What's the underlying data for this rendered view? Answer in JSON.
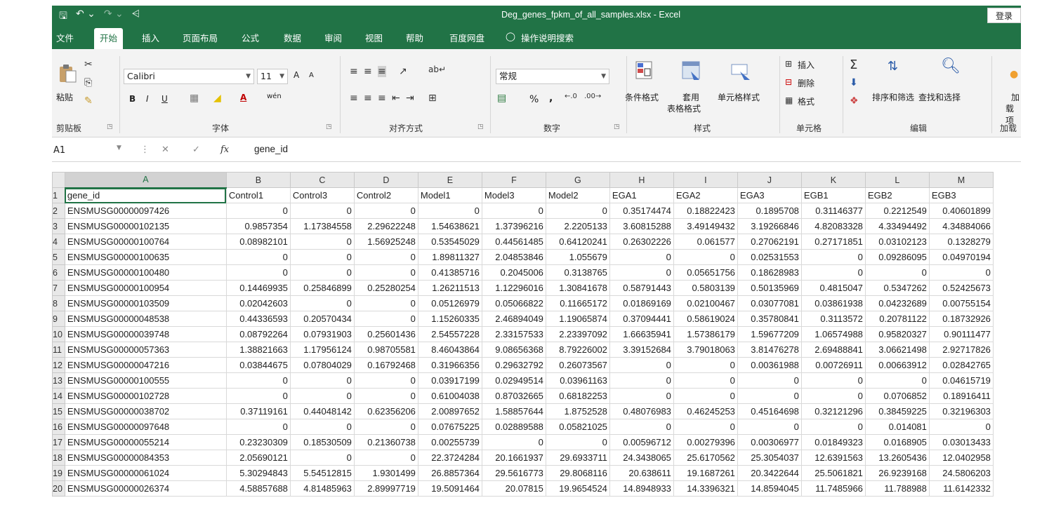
{
  "window": {
    "title": "Deg_genes_fpkm_of_all_samples.xlsx  -  Excel",
    "login": "登录",
    "qat_icons": [
      "save-icon",
      "undo-icon",
      "redo-icon",
      "customize-icon"
    ]
  },
  "tabs": [
    "文件",
    "开始",
    "插入",
    "页面布局",
    "公式",
    "数据",
    "审阅",
    "视图",
    "帮助",
    "百度网盘",
    "操作说明搜索"
  ],
  "active_tab": "开始",
  "ribbon": {
    "clipboard": {
      "paste": "粘贴",
      "group": "剪贴板"
    },
    "font": {
      "name": "Calibri",
      "size": "11",
      "bold": "B",
      "italic": "I",
      "underline": "U",
      "group": "字体",
      "grow": "A",
      "shrink": "A",
      "phonetic": "wén"
    },
    "alignment": {
      "group": "对齐方式"
    },
    "number": {
      "format": "常规",
      "percent": "%",
      "comma": ",",
      "group": "数字"
    },
    "styles": {
      "conditional": "条件格式",
      "table1": "套用",
      "table2": "表格格式",
      "cell_styles": "单元格样式",
      "group": "样式"
    },
    "cells": {
      "insert": "插入",
      "delete": "删除",
      "format": "格式",
      "group": "单元格"
    },
    "editing": {
      "sort": "排序和筛选",
      "find": "查找和选择",
      "group": "编辑"
    },
    "addins": {
      "label1": "加",
      "label2": "载项",
      "group": "加载"
    }
  },
  "formula_bar": {
    "name_box": "A1",
    "fx": "fx",
    "formula": "gene_id"
  },
  "grid": {
    "columns": [
      "A",
      "B",
      "C",
      "D",
      "E",
      "F",
      "G",
      "H",
      "I",
      "J",
      "K",
      "L",
      "M"
    ],
    "selected_cell": "A1",
    "rows": [
      {
        "n": "1",
        "cells": [
          "gene_id",
          "Control1",
          "Control3",
          "Control2",
          "Model1",
          "Model3",
          "Model2",
          "EGA1",
          "EGA2",
          "EGA3",
          "EGB1",
          "EGB2",
          "EGB3"
        ]
      },
      {
        "n": "2",
        "cells": [
          "ENSMUSG00000097426",
          "0",
          "0",
          "0",
          "0",
          "0",
          "0",
          "0.35174474",
          "0.18822423",
          "0.1895708",
          "0.31146377",
          "0.2212549",
          "0.40601899"
        ]
      },
      {
        "n": "3",
        "cells": [
          "ENSMUSG00000102135",
          "0.9857354",
          "1.17384558",
          "2.29622248",
          "1.54638621",
          "1.37396216",
          "2.2205133",
          "3.60815288",
          "3.49149432",
          "3.19266846",
          "4.82083328",
          "4.33494492",
          "4.34884066"
        ]
      },
      {
        "n": "4",
        "cells": [
          "ENSMUSG00000100764",
          "0.08982101",
          "0",
          "1.56925248",
          "0.53545029",
          "0.44561485",
          "0.64120241",
          "0.26302226",
          "0.061577",
          "0.27062191",
          "0.27171851",
          "0.03102123",
          "0.1328279"
        ]
      },
      {
        "n": "5",
        "cells": [
          "ENSMUSG00000100635",
          "0",
          "0",
          "0",
          "1.89811327",
          "2.04853846",
          "1.055679",
          "0",
          "0",
          "0.02531553",
          "0",
          "0.09286095",
          "0.04970194"
        ]
      },
      {
        "n": "6",
        "cells": [
          "ENSMUSG00000100480",
          "0",
          "0",
          "0",
          "0.41385716",
          "0.2045006",
          "0.3138765",
          "0",
          "0.05651756",
          "0.18628983",
          "0",
          "0",
          "0"
        ]
      },
      {
        "n": "7",
        "cells": [
          "ENSMUSG00000100954",
          "0.14469935",
          "0.25846899",
          "0.25280254",
          "1.26211513",
          "1.12296016",
          "1.30841678",
          "0.58791443",
          "0.5803139",
          "0.50135969",
          "0.4815047",
          "0.5347262",
          "0.52425673"
        ]
      },
      {
        "n": "8",
        "cells": [
          "ENSMUSG00000103509",
          "0.02042603",
          "0",
          "0",
          "0.05126979",
          "0.05066822",
          "0.11665172",
          "0.01869169",
          "0.02100467",
          "0.03077081",
          "0.03861938",
          "0.04232689",
          "0.00755154"
        ]
      },
      {
        "n": "9",
        "cells": [
          "ENSMUSG00000048538",
          "0.44336593",
          "0.20570434",
          "0",
          "1.15260335",
          "2.46894049",
          "1.19065874",
          "0.37094441",
          "0.58619024",
          "0.35780841",
          "0.3113572",
          "0.20781122",
          "0.18732926"
        ]
      },
      {
        "n": "10",
        "cells": [
          "ENSMUSG00000039748",
          "0.08792264",
          "0.07931903",
          "0.25601436",
          "2.54557228",
          "2.33157533",
          "2.23397092",
          "1.66635941",
          "1.57386179",
          "1.59677209",
          "1.06574988",
          "0.95820327",
          "0.90111477"
        ]
      },
      {
        "n": "11",
        "cells": [
          "ENSMUSG00000057363",
          "1.38821663",
          "1.17956124",
          "0.98705581",
          "8.46043864",
          "9.08656368",
          "8.79226002",
          "3.39152684",
          "3.79018063",
          "3.81476278",
          "2.69488841",
          "3.06621498",
          "2.92717826"
        ]
      },
      {
        "n": "12",
        "cells": [
          "ENSMUSG00000047216",
          "0.03844675",
          "0.07804029",
          "0.16792468",
          "0.31966356",
          "0.29632792",
          "0.26073567",
          "0",
          "0",
          "0.00361988",
          "0.00726911",
          "0.00663912",
          "0.02842765"
        ]
      },
      {
        "n": "13",
        "cells": [
          "ENSMUSG00000100555",
          "0",
          "0",
          "0",
          "0.03917199",
          "0.02949514",
          "0.03961163",
          "0",
          "0",
          "0",
          "0",
          "0",
          "0.04615719"
        ]
      },
      {
        "n": "14",
        "cells": [
          "ENSMUSG00000102728",
          "0",
          "0",
          "0",
          "0.61004038",
          "0.87032665",
          "0.68182253",
          "0",
          "0",
          "0",
          "0",
          "0.0706852",
          "0.18916411"
        ]
      },
      {
        "n": "15",
        "cells": [
          "ENSMUSG00000038702",
          "0.37119161",
          "0.44048142",
          "0.62356206",
          "2.00897652",
          "1.58857644",
          "1.8752528",
          "0.48076983",
          "0.46245253",
          "0.45164698",
          "0.32121296",
          "0.38459225",
          "0.32196303"
        ]
      },
      {
        "n": "16",
        "cells": [
          "ENSMUSG00000097648",
          "0",
          "0",
          "0",
          "0.07675225",
          "0.02889588",
          "0.05821025",
          "0",
          "0",
          "0",
          "0",
          "0.014081",
          "0"
        ]
      },
      {
        "n": "17",
        "cells": [
          "ENSMUSG00000055214",
          "0.23230309",
          "0.18530509",
          "0.21360738",
          "0.00255739",
          "0",
          "0",
          "0.00596712",
          "0.00279396",
          "0.00306977",
          "0.01849323",
          "0.0168905",
          "0.03013433"
        ]
      },
      {
        "n": "18",
        "cells": [
          "ENSMUSG00000084353",
          "2.05690121",
          "0",
          "0",
          "22.3724284",
          "20.1661937",
          "29.6933711",
          "24.3438065",
          "25.6170562",
          "25.3054037",
          "12.6391563",
          "13.2605436",
          "12.0402958"
        ]
      },
      {
        "n": "19",
        "cells": [
          "ENSMUSG00000061024",
          "5.30294843",
          "5.54512815",
          "1.9301499",
          "26.8857364",
          "29.5616773",
          "29.8068116",
          "20.638611",
          "19.1687261",
          "20.3422644",
          "25.5061821",
          "26.9239168",
          "24.5806203"
        ]
      },
      {
        "n": "20",
        "cells": [
          "ENSMUSG00000026374",
          "4.58857688",
          "4.81485963",
          "2.89997719",
          "19.5091464",
          "20.07815",
          "19.9654524",
          "14.8948933",
          "14.3396321",
          "14.8594045",
          "11.7485966",
          "11.788988",
          "11.6142332"
        ]
      }
    ]
  }
}
